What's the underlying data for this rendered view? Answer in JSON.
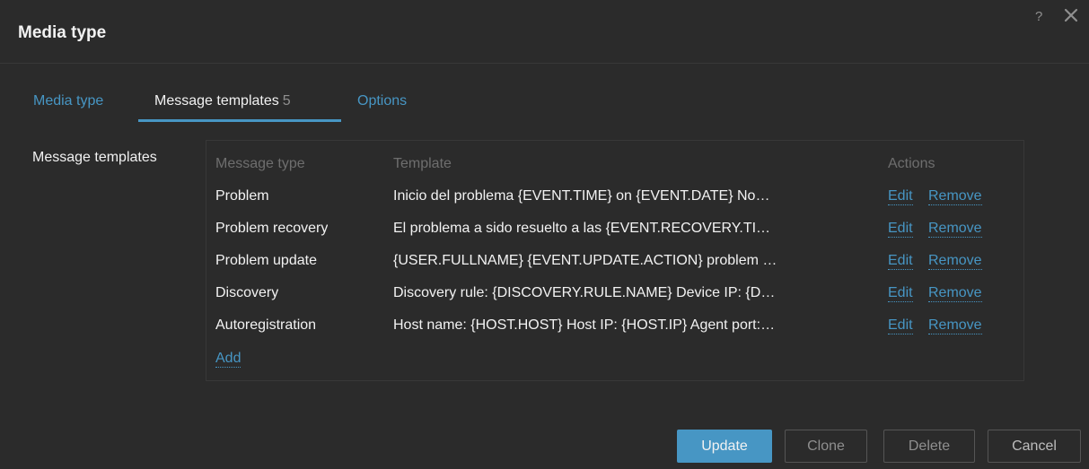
{
  "dialog": {
    "title": "Media type",
    "help": "?"
  },
  "tabs": [
    {
      "label": "Media type"
    },
    {
      "label": "Message templates",
      "count": "5"
    },
    {
      "label": "Options"
    }
  ],
  "section_label": "Message templates",
  "table": {
    "headers": {
      "type": "Message type",
      "template": "Template",
      "actions": "Actions"
    },
    "rows": [
      {
        "type": "Problem",
        "template": "Inicio del problema {EVENT.TIME} on {EVENT.DATE} No…",
        "edit": "Edit",
        "remove": "Remove"
      },
      {
        "type": "Problem recovery",
        "template": "El problema a sido resuelto a las {EVENT.RECOVERY.TI…",
        "edit": "Edit",
        "remove": "Remove"
      },
      {
        "type": "Problem update",
        "template": "{USER.FULLNAME} {EVENT.UPDATE.ACTION} problem …",
        "edit": "Edit",
        "remove": "Remove"
      },
      {
        "type": "Discovery",
        "template": "Discovery rule: {DISCOVERY.RULE.NAME} Device IP: {D…",
        "edit": "Edit",
        "remove": "Remove"
      },
      {
        "type": "Autoregistration",
        "template": "Host name: {HOST.HOST} Host IP: {HOST.IP} Agent port:…",
        "edit": "Edit",
        "remove": "Remove"
      }
    ],
    "add": "Add"
  },
  "buttons": {
    "update": "Update",
    "clone": "Clone",
    "delete": "Delete",
    "cancel": "Cancel"
  },
  "colors": {
    "accent": "#4796c4",
    "background": "#2b2b2b",
    "text": "#f2f2f2",
    "muted": "#6e6e6e"
  }
}
